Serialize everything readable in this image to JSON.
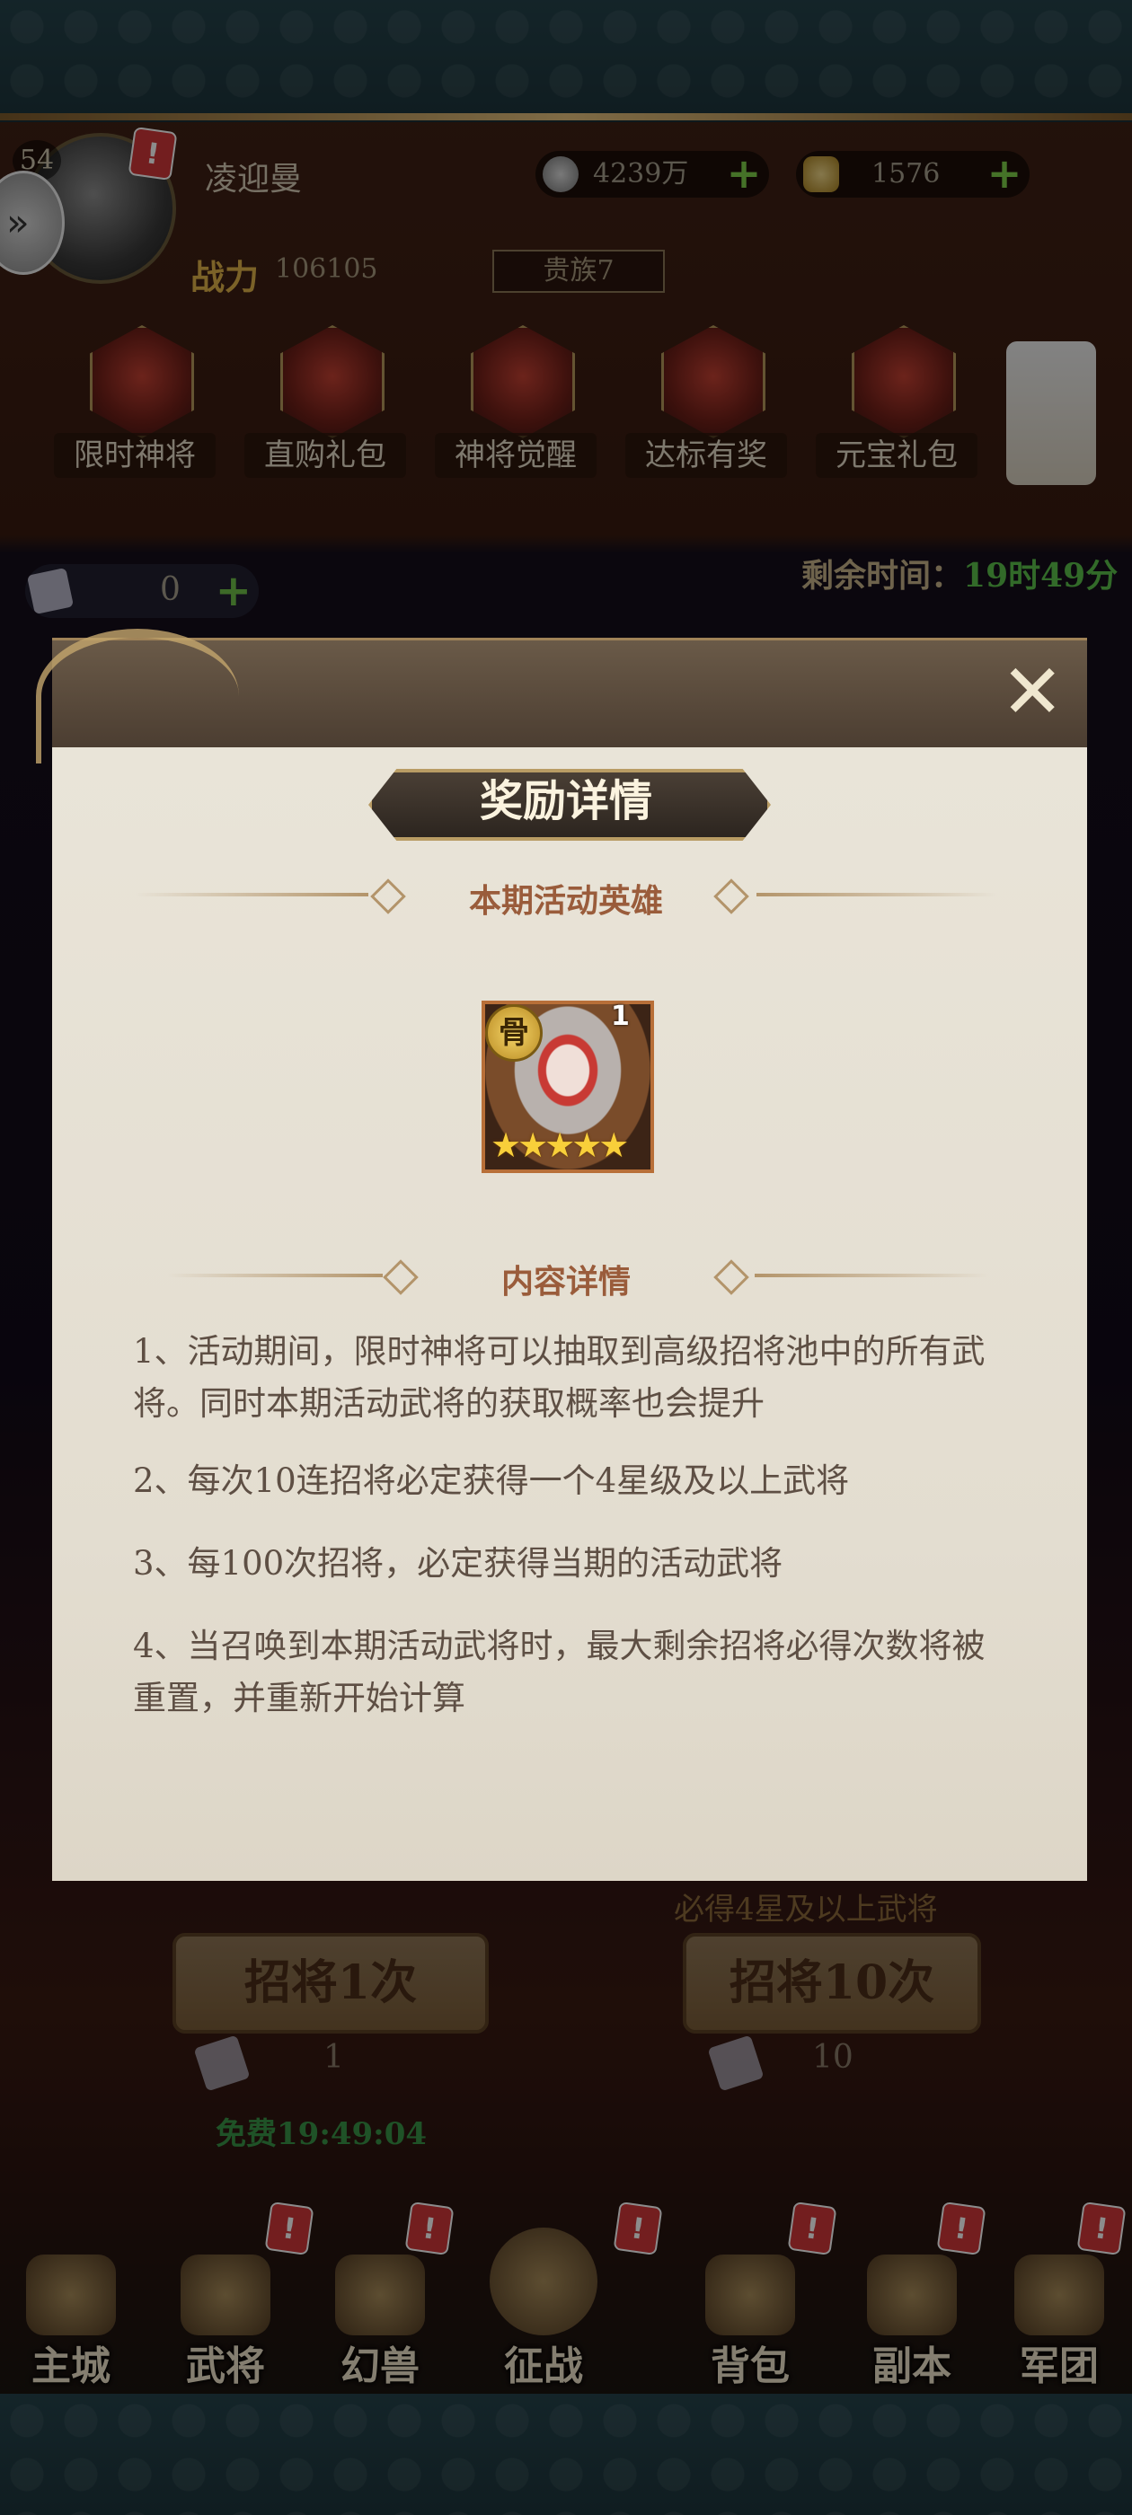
{
  "header": {
    "level": "54",
    "player_name": "凌迎曼",
    "badge": "!",
    "coins": "4239万",
    "ingots": "1576",
    "power_label": "战力",
    "power_value": "106105",
    "noble": "贵族7"
  },
  "activities": [
    {
      "label": "限时神将"
    },
    {
      "label": "直购礼包"
    },
    {
      "label": "神将觉醒"
    },
    {
      "label": "达标有奖"
    },
    {
      "label": "元宝礼包"
    }
  ],
  "ticket": {
    "count": "0"
  },
  "timer": {
    "label": "剩余时间：",
    "value": "19时49分"
  },
  "modal": {
    "title": "奖励详情",
    "hero_section": "本期活动英雄",
    "hero": {
      "grade": "骨",
      "count": "1",
      "stars": 5
    },
    "content_section": "内容详情",
    "rules": [
      "1、活动期间，限时神将可以抽取到高级招将池中的所有武将。同时本期活动武将的获取概率也会提升",
      "2、每次10连招将必定获得一个4星级及以上武将",
      "3、每100次招将，必定获得当期的活动武将",
      "4、当召唤到本期活动武将时，最大剩余招将必得次数将被重置，并重新开始计算"
    ]
  },
  "draw": {
    "guarantee": "必得4星及以上武将",
    "single_label": "招将1次",
    "single_cost": "1",
    "ten_label": "招将10次",
    "ten_cost": "10",
    "free_label": "免费19:49:04"
  },
  "nav": [
    {
      "label": "主城"
    },
    {
      "label": "武将"
    },
    {
      "label": "幻兽"
    },
    {
      "label": "征战"
    },
    {
      "label": "背包"
    },
    {
      "label": "副本"
    },
    {
      "label": "军团"
    }
  ]
}
